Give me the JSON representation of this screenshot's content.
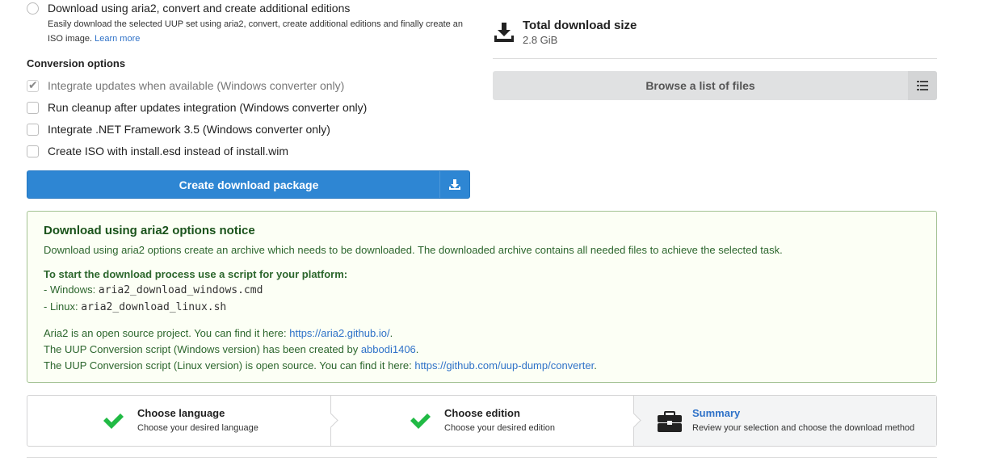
{
  "download_option": {
    "label": "Download using aria2, convert and create additional editions",
    "description": "Easily download the selected UUP set using aria2, convert, create additional editions and finally create an ISO image.",
    "learn_more": "Learn more"
  },
  "conversion": {
    "title": "Conversion options",
    "options": [
      {
        "label": "Integrate updates when available (Windows converter only)",
        "checked": true,
        "disabled": true
      },
      {
        "label": "Run cleanup after updates integration (Windows converter only)",
        "checked": false,
        "disabled": false
      },
      {
        "label": "Integrate .NET Framework 3.5 (Windows converter only)",
        "checked": false,
        "disabled": false
      },
      {
        "label": "Create ISO with install.esd instead of install.wim",
        "checked": false,
        "disabled": false
      }
    ],
    "create_button": "Create download package"
  },
  "summary": {
    "size_title": "Total download size",
    "size_value": "2.8 GiB",
    "browse_button": "Browse a list of files"
  },
  "notice": {
    "title": "Download using aria2 options notice",
    "intro": "Download using aria2 options create an archive which needs to be downloaded. The downloaded archive contains all needed files to achieve the selected task.",
    "script_heading": "To start the download process use a script for your platform:",
    "windows_prefix": "- Windows: ",
    "windows_script": "aria2_download_windows.cmd",
    "linux_prefix": "- Linux: ",
    "linux_script": "aria2_download_linux.sh",
    "aria2_text": "Aria2 is an open source project. You can find it here: ",
    "aria2_link": "https://aria2.github.io/",
    "win_conv_text": "The UUP Conversion script (Windows version) has been created by ",
    "win_conv_link": "abbodi1406",
    "linux_conv_text": "The UUP Conversion script (Linux version) is open source. You can find it here: ",
    "linux_conv_link": "https://github.com/uup-dump/converter",
    "period": "."
  },
  "steps": [
    {
      "title": "Choose language",
      "desc": "Choose your desired language",
      "icon": "check-icon",
      "state": "completed"
    },
    {
      "title": "Choose edition",
      "desc": "Choose your desired edition",
      "icon": "check-icon",
      "state": "completed"
    },
    {
      "title": "Summary",
      "desc": "Review your selection and choose the download method",
      "icon": "briefcase-icon",
      "state": "active"
    }
  ],
  "colors": {
    "primary": "#2e86d3",
    "link": "#2f72c8",
    "success": "#21ba45",
    "notice_bg": "#fcfff5",
    "notice_border": "#a3c293",
    "notice_text": "#2c662d"
  }
}
